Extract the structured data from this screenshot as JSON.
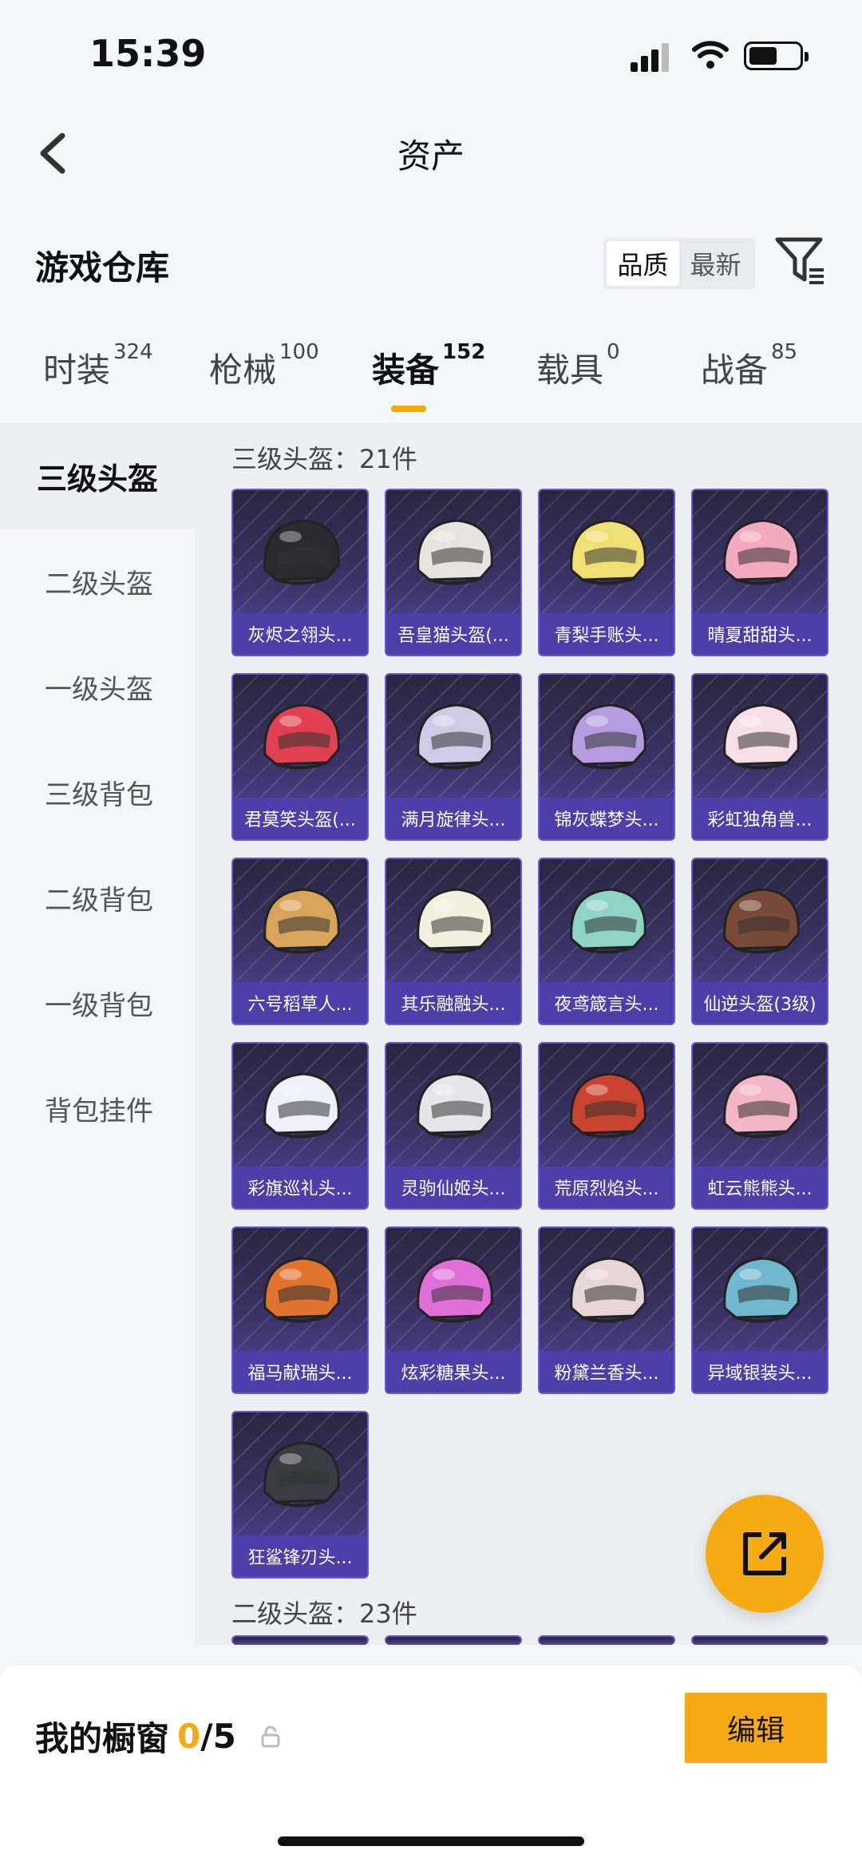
{
  "status": {
    "time": "15:39"
  },
  "nav": {
    "title": "资产"
  },
  "section": {
    "title": "游戏仓库",
    "sort_options": [
      "品质",
      "最新"
    ]
  },
  "tabs": [
    {
      "label": "时装",
      "count": "324"
    },
    {
      "label": "枪械",
      "count": "100"
    },
    {
      "label": "装备",
      "count": "152"
    },
    {
      "label": "载具",
      "count": "0"
    },
    {
      "label": "战备",
      "count": "85"
    }
  ],
  "sidebar": [
    "三级头盔",
    "二级头盔",
    "一级头盔",
    "三级背包",
    "二级背包",
    "一级背包",
    "背包挂件"
  ],
  "groups": [
    {
      "title": "三级头盔：21件"
    },
    {
      "title": "二级头盔：23件"
    }
  ],
  "items": [
    {
      "name": "灰烬之翎头...",
      "color": "#2a2a30"
    },
    {
      "name": "吾皇猫头盔(...",
      "color": "#e8e3de"
    },
    {
      "name": "青梨手账头...",
      "color": "#f0df74"
    },
    {
      "name": "晴夏甜甜头...",
      "color": "#f3a9c0"
    },
    {
      "name": "君莫笑头盔(...",
      "color": "#e04050"
    },
    {
      "name": "满月旋律头...",
      "color": "#cfcbe6"
    },
    {
      "name": "锦灰蝶梦头...",
      "color": "#b79be0"
    },
    {
      "name": "彩虹独角兽...",
      "color": "#f7dfe8"
    },
    {
      "name": "六号稻草人...",
      "color": "#d8a45a"
    },
    {
      "name": "其乐融融头...",
      "color": "#f5efdf"
    },
    {
      "name": "夜鸢箴言头...",
      "color": "#8fd3c6"
    },
    {
      "name": "仙逆头盔(3级)",
      "color": "#7a4a38"
    },
    {
      "name": "彩旗巡礼头...",
      "color": "#eef0fa"
    },
    {
      "name": "灵驹仙姬头...",
      "color": "#e6e6ea"
    },
    {
      "name": "荒原烈焰头...",
      "color": "#c8442e"
    },
    {
      "name": "虹云熊熊头...",
      "color": "#f2b6c8"
    },
    {
      "name": "福马献瑞头...",
      "color": "#e0742e"
    },
    {
      "name": "炫彩糖果头...",
      "color": "#e070d8"
    },
    {
      "name": "粉黛兰香头...",
      "color": "#e8d5d8"
    },
    {
      "name": "异域银装头...",
      "color": "#6fb8d0"
    },
    {
      "name": "狂鲨锋刃头...",
      "color": "#3a3c44"
    }
  ],
  "showcase": {
    "label": "我的橱窗",
    "count": "0",
    "total": "/5"
  },
  "edit_label": "编辑"
}
